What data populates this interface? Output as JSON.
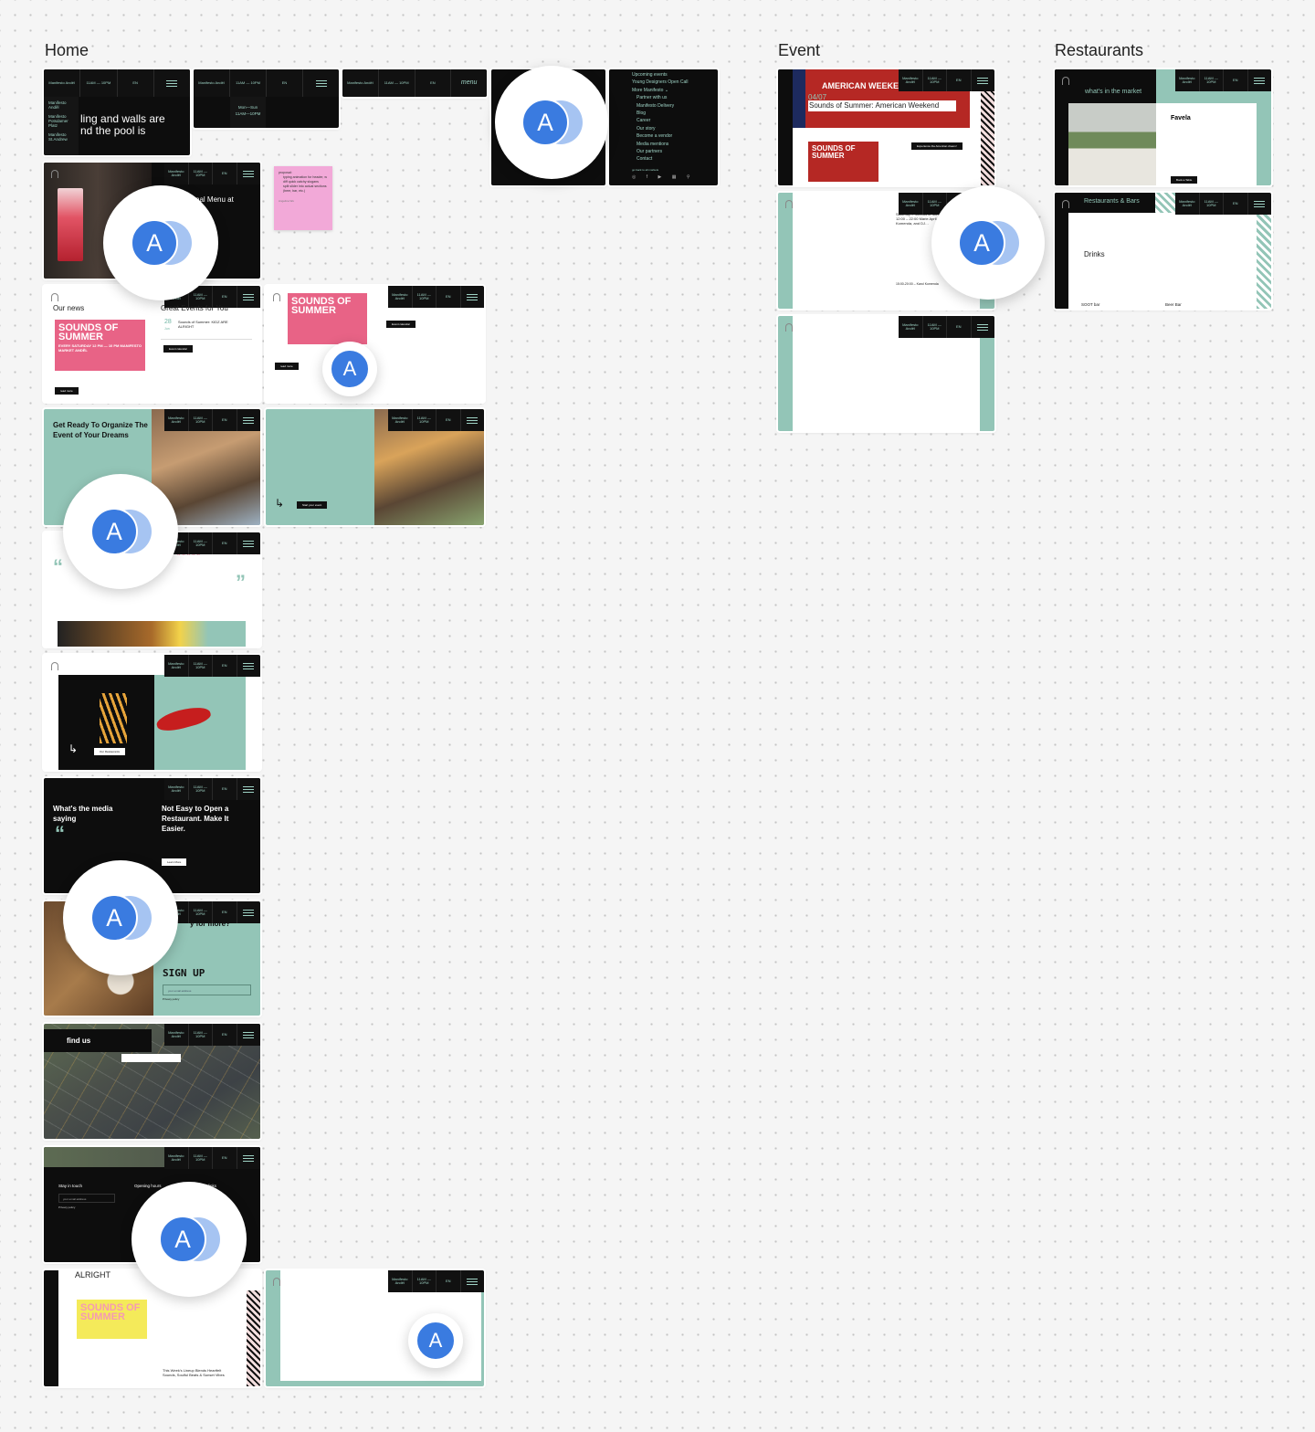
{
  "sections": {
    "home": "Home",
    "event": "Event",
    "restaurants": "Restaurants"
  },
  "header": {
    "location": "Manifesto Anděl",
    "hours": "11AM — 10PM",
    "language": "EN",
    "menu_word": "menu"
  },
  "home": {
    "dropdown": {
      "items": [
        "Manifesto Anděl",
        "Manifesto Potsdamer Platz",
        "Manifesto St.Andrew"
      ],
      "hero_line1": "ling and walls are",
      "hero_line2": "nd the pool is"
    },
    "hours_dropdown": {
      "days": "Mon—Sun",
      "time": "11AM—10PM"
    },
    "menu_panel": {
      "items": [
        "Upcoming events",
        "Young Designers Open Call",
        "More Manifesto ⌄",
        "Partner with us",
        "Manifesto Delivery",
        "Blog",
        "Career",
        "Our story",
        "Become a vendor",
        "Media mentions",
        "Our partners",
        "Contact"
      ],
      "back": "go back to all markets"
    },
    "sticky": {
      "title": "proposal:",
      "items": [
        "typing animation for header, w diff quick catchy slogans",
        "split slider into actual sections (beer, bar, etc.)"
      ],
      "author": "Angelina Wu"
    },
    "menu_hero": {
      "title": "nal Menu at"
    },
    "news": {
      "title": "Our news",
      "events_title": "Great Events for You",
      "event_day": "28",
      "event_month": "Jun",
      "event_name": "Sounds of Summer: KIDZ ARE ALRIGHT",
      "calendar_btn": "Event calendar",
      "read_more": "read more",
      "poster": "SOUNDS OF SUMMER",
      "poster_sub": "EVERY SATURDAY 12 PM — 10 PM MANIFESTO MARKET ANDĚL"
    },
    "organize": {
      "title": "Get Ready To Organize The Event of Your Dreams",
      "btn": "Start your event"
    },
    "media": {
      "title": "What's the media saying",
      "title2": "Not Easy to Open a Restaurant. Make It Easier.",
      "btn": "Learn More"
    },
    "signup": {
      "title": "y for more?",
      "script": "SIGN UP",
      "placeholder": "your email address",
      "privacy": "Privacy policy"
    },
    "findus": {
      "title": "find us"
    },
    "footer": {
      "stay": "Stay in touch",
      "hours": "Opening hours",
      "links": "links",
      "placeholder": "your email address",
      "privacy": "Privacy policy"
    },
    "alright": {
      "title": "ALRIGHT",
      "lineup": "This Week's Lineup Blends Heartfelt Sounds, Soulful Beats & Sunset Vibes"
    },
    "fries": {
      "btn": "Our Restaurants"
    }
  },
  "event": {
    "banner": "AMERICAN WEEKEND",
    "date": "04/07",
    "title": "Sounds of Summer: American Weekend",
    "cta": "Experience the American dream!",
    "poster": "SOUNDS OF SUMMER",
    "schedule": "Saturday – Sounds of Summer 12:00 – 22:00 Marie April, Karol Komenda, and DJ…",
    "slot2": "15:00-20:00 – Karol Komenda"
  },
  "restaurants": {
    "market_title": "what's in the market",
    "favela": "Favela",
    "book_btn": "Book a Table",
    "rb_title": "Restaurants & Bars",
    "drinks": "Drinks",
    "soot": "SOOT bar",
    "beer": "Beer Bar"
  },
  "cursor": {
    "initial": "A"
  },
  "colors": {
    "teal": "#93c5b7",
    "black": "#0d0d0d",
    "cursor": "#3a7be0",
    "sticky": "#f2a9d8"
  }
}
